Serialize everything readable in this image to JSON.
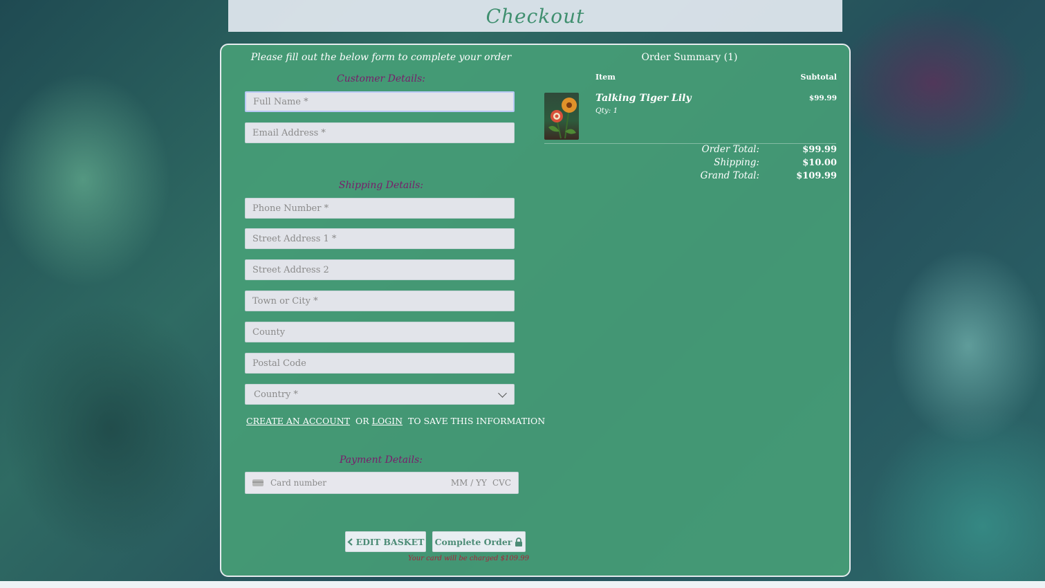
{
  "header": {
    "title": "Checkout"
  },
  "form": {
    "intro": "Please fill out the below form to complete your order",
    "customer_title": "Customer Details:",
    "full_name_placeholder": "Full Name *",
    "email_placeholder": "Email Address *",
    "shipping_title": "Shipping Details:",
    "phone_placeholder": "Phone Number *",
    "street1_placeholder": "Street Address 1 *",
    "street2_placeholder": "Street Address 2",
    "town_placeholder": "Town or City *",
    "county_placeholder": "County",
    "postal_placeholder": "Postal Code",
    "country_selected": "Country *",
    "create_account_link": "CREATE AN ACCOUNT",
    "or_text": "OR",
    "login_link": "LOGIN",
    "save_text": "TO SAVE THIS INFORMATION",
    "payment_title": "Payment Details:",
    "card_number_placeholder": "Card number",
    "card_expiry_placeholder": "MM / YY",
    "card_cvc_placeholder": "CVC",
    "edit_basket_label": "EDIT BASKET",
    "complete_order_label": "Complete Order",
    "charge_note": "Your card will be charged $109.99"
  },
  "summary": {
    "title": "Order Summary (1)",
    "col_item": "Item",
    "col_subtotal": "Subtotal",
    "items": [
      {
        "name": "Talking Tiger Lily",
        "qty": "Qty: 1",
        "price": "$99.99"
      }
    ],
    "order_total_label": "Order Total:",
    "order_total": "$99.99",
    "shipping_label": "Shipping:",
    "shipping": "$10.00",
    "grand_total_label": "Grand Total:",
    "grand_total": "$109.99"
  }
}
